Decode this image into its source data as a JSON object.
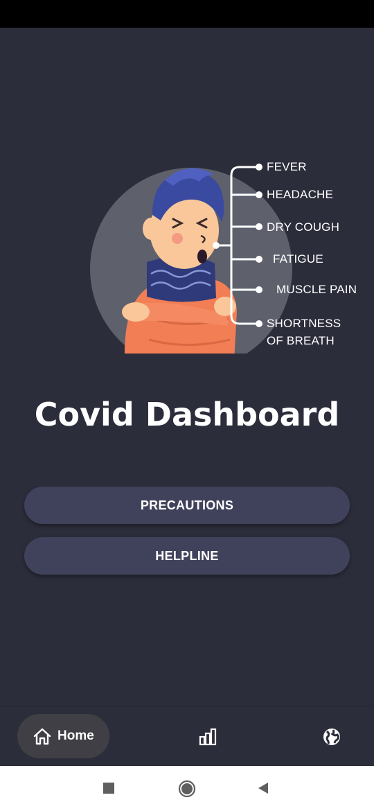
{
  "app": {
    "title": "Covid Dashboard"
  },
  "illustration": {
    "symptoms": [
      "FEVER",
      "HEADACHE",
      "DRY COUGH",
      "FATIGUE",
      "MUSCLE PAIN",
      "SHORTNESS",
      "OF BREATH"
    ]
  },
  "buttons": {
    "precautions_label": "PRECAUTIONS",
    "helpline_label": "HELPLINE"
  },
  "bottom_nav": {
    "items": [
      {
        "label": "Home",
        "icon": "home-icon",
        "selected": true
      },
      {
        "label": "",
        "icon": "bar-chart-icon",
        "selected": false
      },
      {
        "label": "",
        "icon": "globe-icon",
        "selected": false
      }
    ]
  },
  "colors": {
    "background": "#2c2d3b",
    "button": "#40415a",
    "nav_selected": "#3f3f45",
    "text": "#ffffff"
  }
}
